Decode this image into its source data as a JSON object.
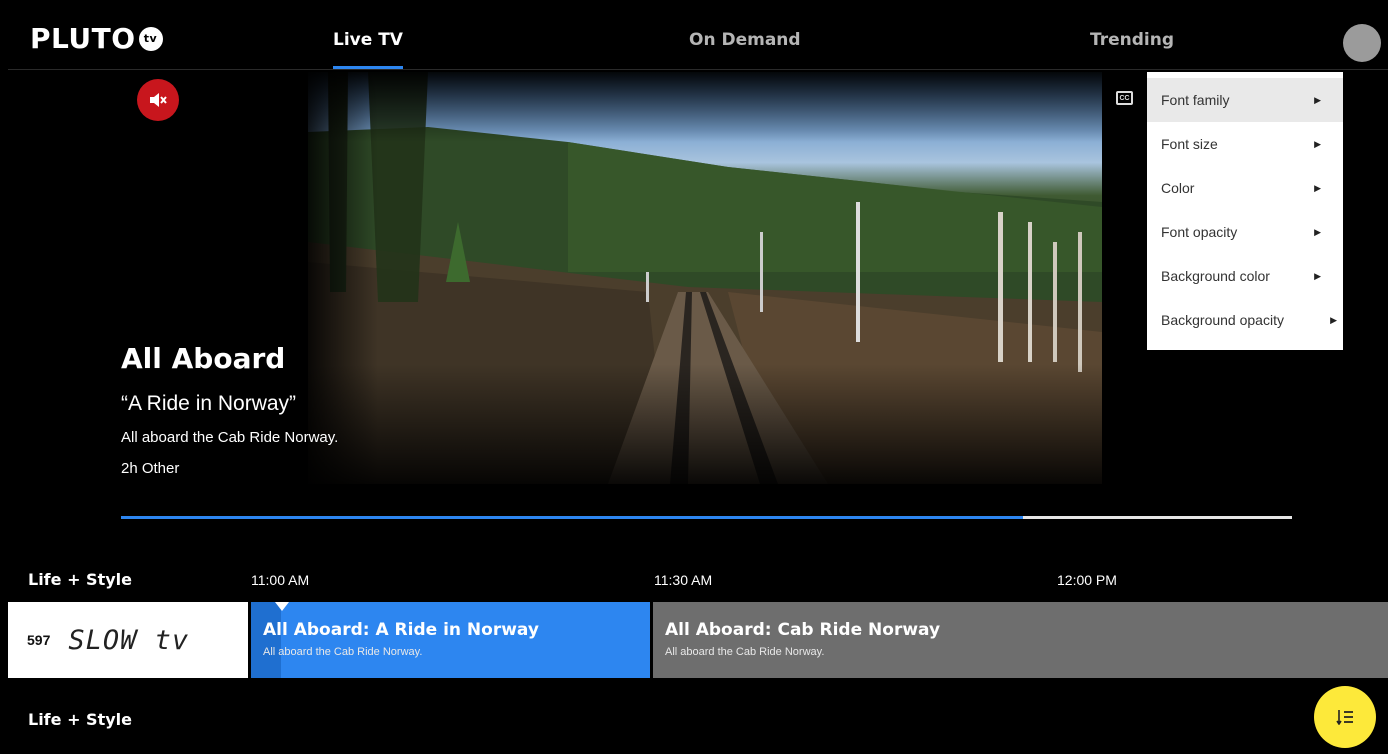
{
  "header": {
    "logo": "PLUTO",
    "logo_badge": "tv",
    "tabs": [
      {
        "label": "Live TV",
        "active": true
      },
      {
        "label": "On Demand",
        "active": false
      },
      {
        "label": "Trending",
        "active": false
      }
    ]
  },
  "player": {
    "mute_icon": "muted-speaker-icon",
    "cc_icon": "closed-captions-icon",
    "progress": 0.77
  },
  "now_playing": {
    "show_title": "All Aboard",
    "episode_title": "“A Ride in Norway”",
    "description": "All aboard the Cab Ride Norway.",
    "meta": "2h Other"
  },
  "captions_menu": {
    "items": [
      {
        "label": "Font family"
      },
      {
        "label": "Font size"
      },
      {
        "label": "Color"
      },
      {
        "label": "Font opacity"
      },
      {
        "label": "Background color"
      },
      {
        "label": "Background opacity"
      }
    ]
  },
  "guide": {
    "category_1": "Life + Style",
    "category_2": "Life + Style",
    "times": [
      "11:00 AM",
      "11:30 AM",
      "12:00 PM"
    ],
    "channel": {
      "number": "597",
      "logo_text": "SLOW tv"
    },
    "programs": [
      {
        "title": "All Aboard: A Ride in Norway",
        "description": "All aboard the Cab Ride Norway."
      },
      {
        "title": "All Aboard: Cab Ride Norway",
        "description": "All aboard the Cab Ride Norway."
      }
    ]
  },
  "colors": {
    "accent": "#2d86f0",
    "mute": "#c8161d",
    "sort_button": "#fde93a"
  },
  "sort_icon": "sort-list-icon"
}
